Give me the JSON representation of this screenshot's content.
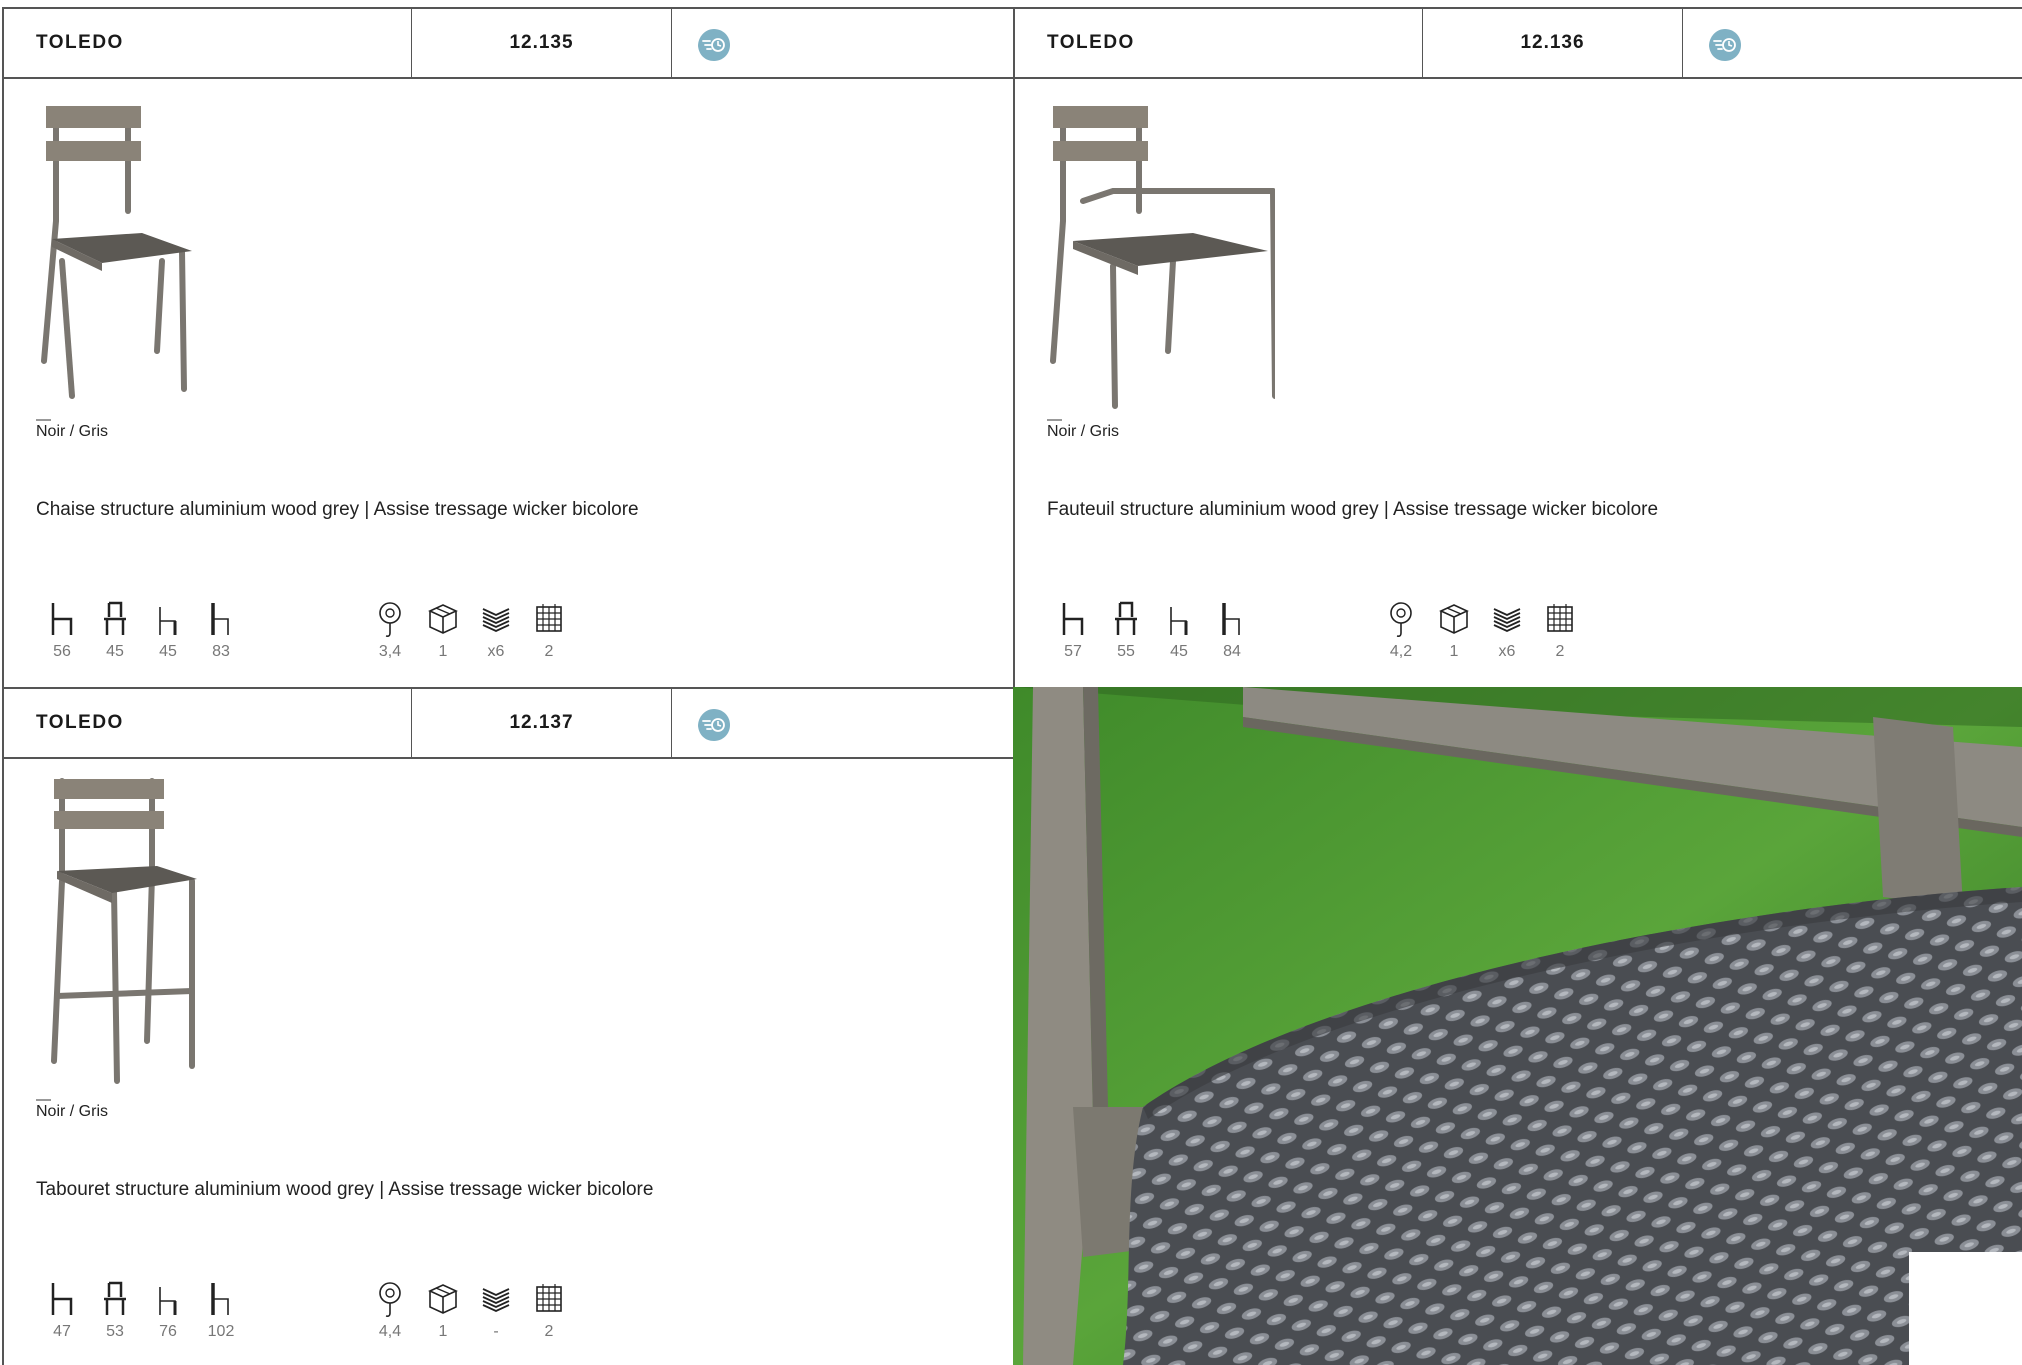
{
  "products": [
    {
      "name": "TOLEDO",
      "ref": "12.135",
      "color": "Noir / Gris",
      "description": "Chaise structure aluminium wood grey | Assise tressage wicker bicolore",
      "dims": [
        "56",
        "45",
        "45",
        "83"
      ],
      "specs": [
        "3,4",
        "1",
        "x6",
        "2"
      ]
    },
    {
      "name": "TOLEDO",
      "ref": "12.136",
      "color": "Noir / Gris",
      "description": "Fauteuil structure aluminium wood grey | Assise tressage wicker bicolore",
      "dims": [
        "57",
        "55",
        "45",
        "84"
      ],
      "specs": [
        "4,2",
        "1",
        "x6",
        "2"
      ]
    },
    {
      "name": "TOLEDO",
      "ref": "12.137",
      "color": "Noir / Gris",
      "description": "Tabouret structure aluminium wood grey | Assise tressage wicker bicolore",
      "dims": [
        "47",
        "53",
        "76",
        "102"
      ],
      "specs": [
        "4,4",
        "1",
        "-",
        "2"
      ]
    }
  ],
  "dash": "—",
  "icons": {
    "badge": "delivery-badge-icon",
    "dims": [
      "width-icon",
      "depth-icon",
      "seat-height-icon",
      "total-height-icon"
    ],
    "specs": [
      "weight-icon",
      "box-icon",
      "stack-icon",
      "calendar-icon"
    ]
  },
  "colors": {
    "badge": "#7fb1c4",
    "border": "#555555",
    "muted": "#777777"
  }
}
